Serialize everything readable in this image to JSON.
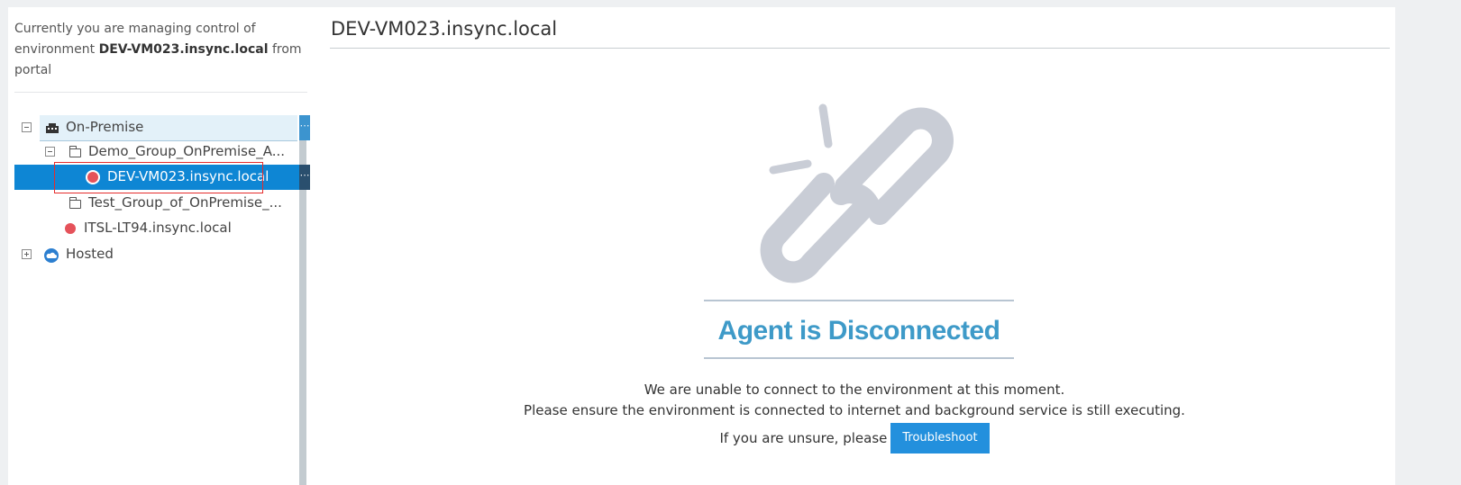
{
  "sidebar": {
    "info_prefix": "Currently you are managing control of environment ",
    "info_env": "DEV-VM023.insync.local",
    "info_suffix": " from portal",
    "tree": {
      "on_premise": "On-Premise",
      "group_demo": "Demo_Group_OnPremise_A...",
      "selected_vm": "DEV-VM023.insync.local",
      "group_test": "Test_Group_of_OnPremise_...",
      "itsl": "ITSL-LT94.insync.local",
      "hosted": "Hosted"
    },
    "colors": {
      "selected_bg": "#0e86d4",
      "offline_dot": "#e5525a"
    }
  },
  "main": {
    "title": "DEV-VM023.insync.local",
    "status_heading": "Agent is Disconnected",
    "message_line1": "We are unable to connect to the environment at this moment.",
    "message_line2": "Please ensure the environment is connected to internet and background service is still executing.",
    "message_line3": "If you are unsure, please",
    "troubleshoot_label": "Troubleshoot",
    "icon": "broken-link-icon",
    "colors": {
      "heading": "#3e9ac8",
      "button": "#2390dd"
    }
  }
}
